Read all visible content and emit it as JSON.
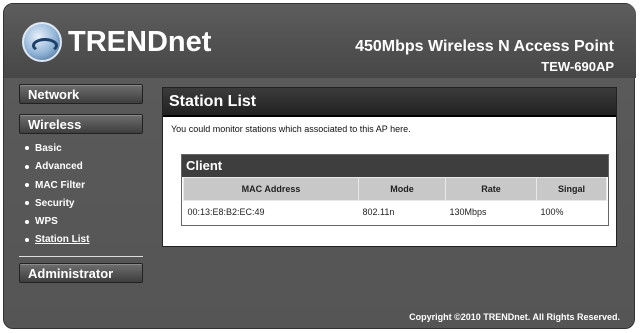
{
  "header": {
    "brand": "TRENDnet",
    "title": "450Mbps Wireless N Access Point",
    "model": "TEW-690AP"
  },
  "sidebar": {
    "network": "Network",
    "wireless": "Wireless",
    "items": [
      {
        "label": "Basic"
      },
      {
        "label": "Advanced"
      },
      {
        "label": "MAC Filter"
      },
      {
        "label": "Security"
      },
      {
        "label": "WPS"
      },
      {
        "label": "Station List"
      }
    ],
    "administrator": "Administrator"
  },
  "content": {
    "title": "Station List",
    "description": "You could monitor stations which associated to this AP here.",
    "client_heading": "Client",
    "columns": [
      "MAC Address",
      "Mode",
      "Rate",
      "Singal"
    ],
    "rows": [
      {
        "mac": "00:13:E8:B2:EC:49",
        "mode": "802.11n",
        "rate": "130Mbps",
        "signal": "100%"
      }
    ]
  },
  "footer": {
    "copyright": "Copyright ©2010 TRENDnet. All Rights Reserved."
  }
}
